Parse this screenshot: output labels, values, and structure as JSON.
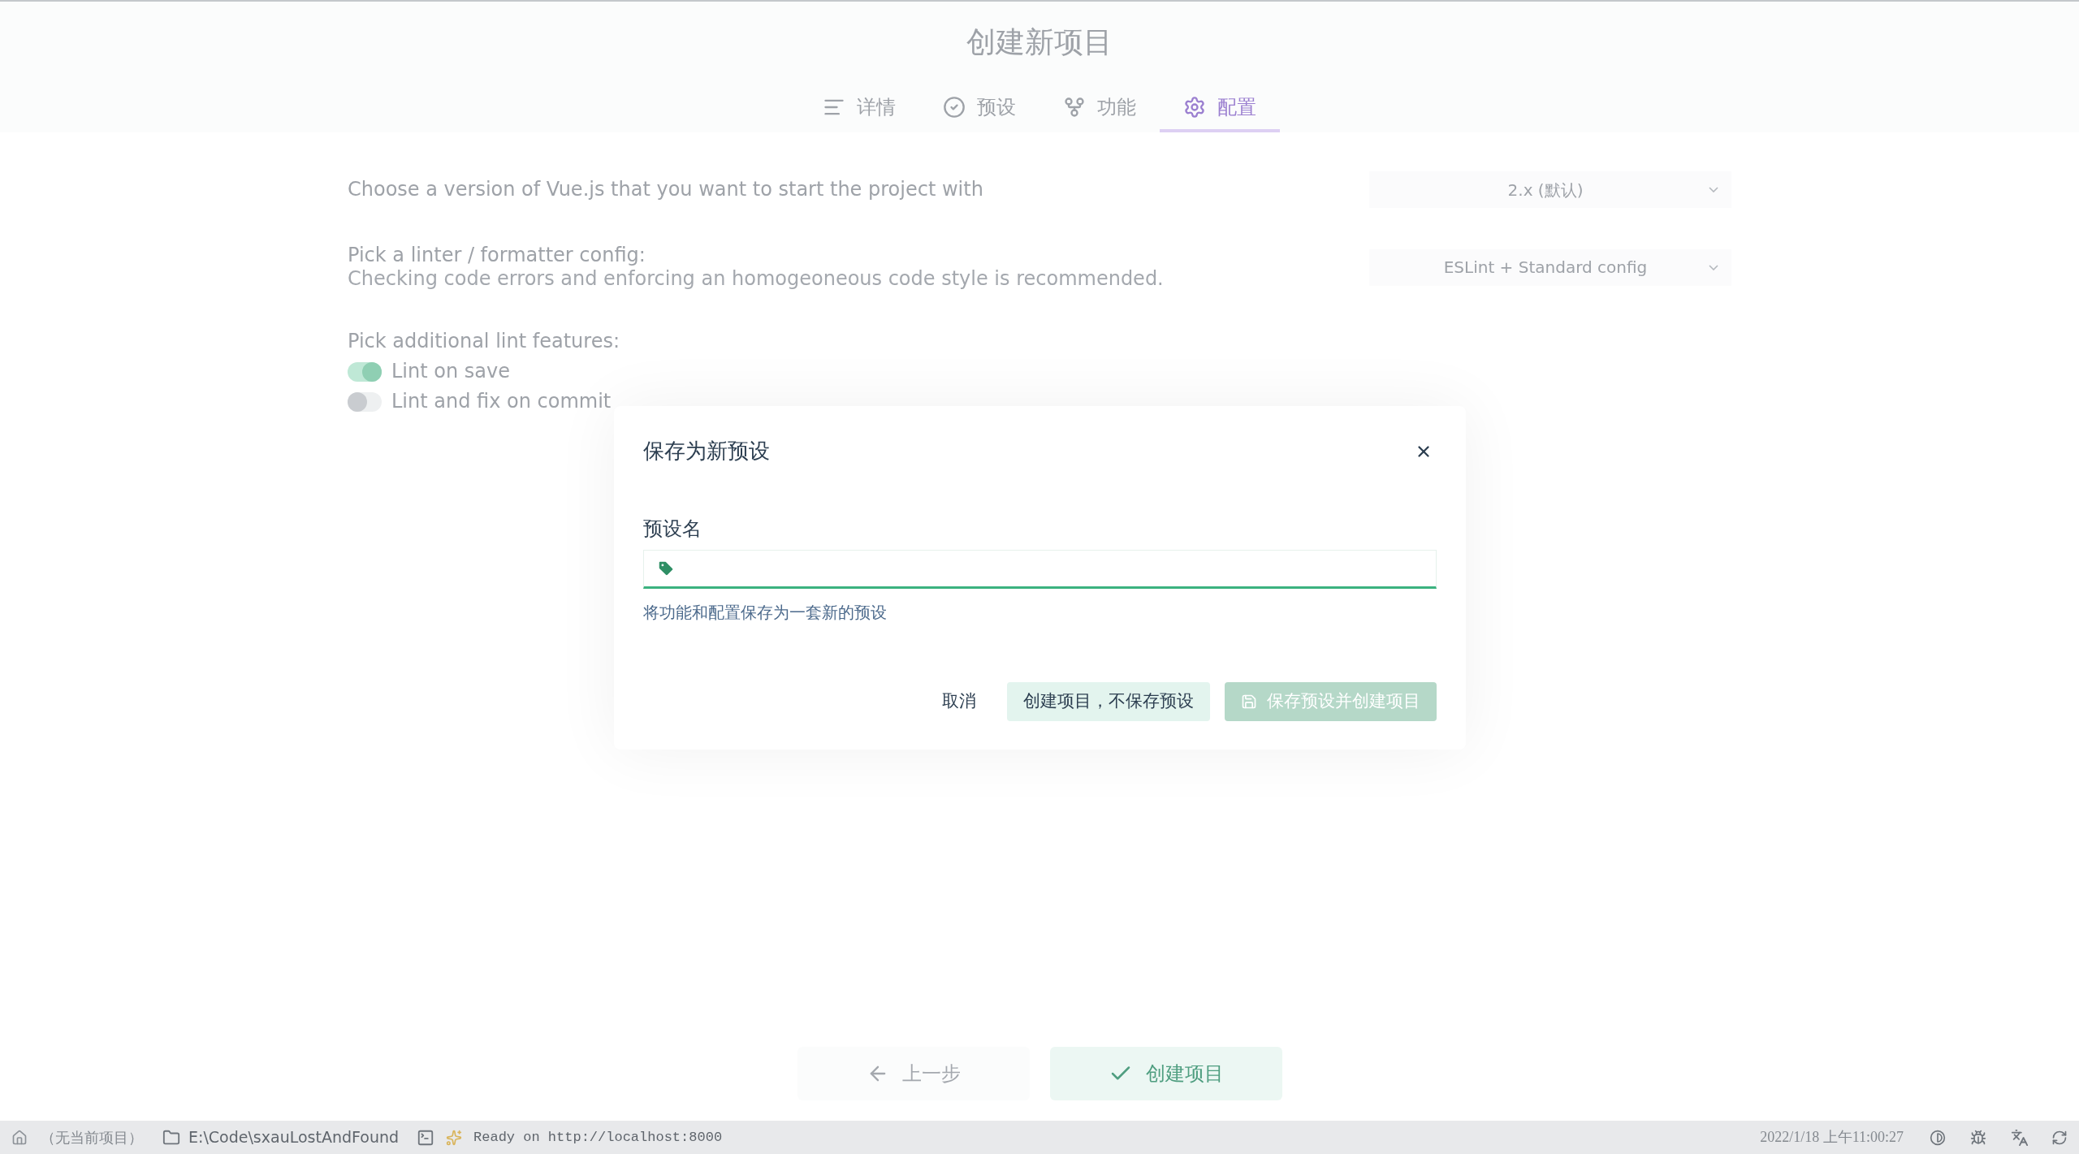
{
  "header": {
    "title": "创建新项目",
    "tabs": [
      {
        "label": "详情",
        "selected": false
      },
      {
        "label": "预设",
        "selected": false
      },
      {
        "label": "功能",
        "selected": false
      },
      {
        "label": "配置",
        "selected": true
      }
    ]
  },
  "form": {
    "rows": [
      {
        "kind": "select",
        "label": "Choose a version of Vue.js that you want to start the project with",
        "value": "2.x (默认)"
      },
      {
        "kind": "select",
        "label": "Pick a linter / formatter config:",
        "description": "Checking code errors and enforcing an homogeoneous code style is recommended.",
        "value": "ESLint + Standard config"
      },
      {
        "kind": "switches",
        "label": "Pick additional lint features:",
        "options": [
          {
            "label": "Lint on save",
            "on": true
          },
          {
            "label": "Lint and fix on commit",
            "on": false
          }
        ]
      }
    ]
  },
  "dialog": {
    "title": "保存为新预设",
    "field_label": "预设名",
    "field_focused": true,
    "hint": "将功能和配置保存为一套新的预设",
    "buttons": [
      {
        "label": "取消",
        "kind": "flat"
      },
      {
        "label": "创建项目，不保存预设",
        "kind": "secondary"
      },
      {
        "label": "保存预设并创建项目",
        "kind": "primary",
        "disabled": true
      }
    ]
  },
  "footer": {
    "buttons": [
      {
        "label": "上一步",
        "kind": "back"
      },
      {
        "label": "创建项目",
        "kind": "create"
      }
    ]
  },
  "status_bar": {
    "project": "（无当前项目）",
    "folder": "E:\\Code\\sxauLostAndFound",
    "log": "Ready on http://localhost:8000",
    "time": "2022/1/18 上午11:00:27"
  }
}
